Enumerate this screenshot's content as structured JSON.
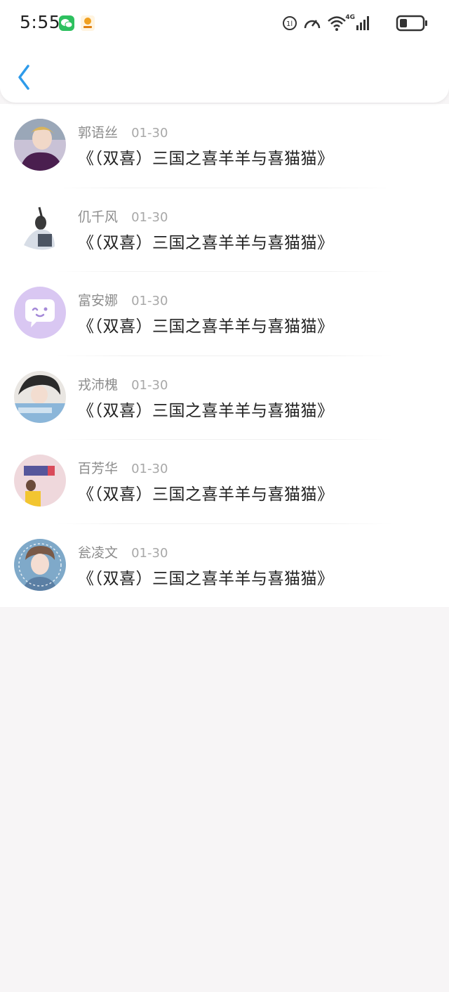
{
  "status_bar": {
    "time": "5:55",
    "network_label": "4G",
    "icons": [
      "wechat-icon",
      "app-notification-icon",
      "hd-call-icon",
      "speed-icon",
      "wifi-icon",
      "signal-icon",
      "battery-icon"
    ]
  },
  "header": {
    "back_icon": "chevron-left-icon"
  },
  "colors": {
    "accent": "#2e9bea",
    "background": "#f7f5f6",
    "name": "#8c8c8c",
    "message": "#222222"
  },
  "list": [
    {
      "name": "郭语丝",
      "date": "01-30",
      "message": "《（双喜）三国之喜羊羊与喜猫猫》"
    },
    {
      "name": "仉千风",
      "date": "01-30",
      "message": "《（双喜）三国之喜羊羊与喜猫猫》"
    },
    {
      "name": "富安娜",
      "date": "01-30",
      "message": "《（双喜）三国之喜羊羊与喜猫猫》"
    },
    {
      "name": "戎沛槐",
      "date": "01-30",
      "message": "《（双喜）三国之喜羊羊与喜猫猫》"
    },
    {
      "name": "百芳华",
      "date": "01-30",
      "message": "《（双喜）三国之喜羊羊与喜猫猫》"
    },
    {
      "name": "瓮凌文",
      "date": "01-30",
      "message": "《（双喜）三国之喜羊羊与喜猫猫》"
    }
  ]
}
